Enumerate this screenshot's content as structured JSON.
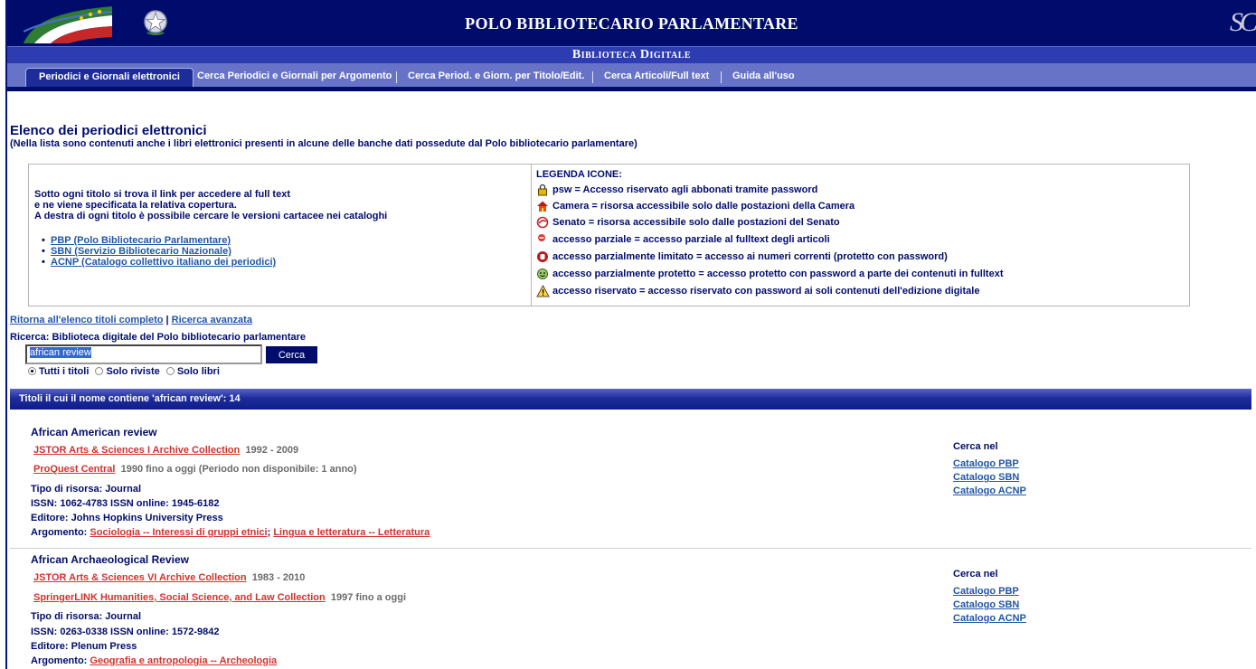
{
  "header": {
    "title": "POLO BIBLIOTECARIO PARLAMENTARE",
    "subtitle": "Biblioteca Digitale",
    "monogram": "SC"
  },
  "nav": {
    "tabs": [
      {
        "label": "Periodici e Giornali elettronici",
        "active": true
      },
      {
        "label": "Cerca Periodici e Giornali per Argomento",
        "active": false
      },
      {
        "label": "Cerca Period. e Giorn. per Titolo/Edit.",
        "active": false
      },
      {
        "label": "Cerca Articoli/Full text",
        "active": false
      },
      {
        "label": "Guida all'uso",
        "active": false
      }
    ]
  },
  "main": {
    "title": "Elenco dei periodici elettronici",
    "subtitle": "(Nella lista sono contenuti anche i libri elettronici presenti in alcune delle banche dati possedute dal Polo bibliotecario parlamentare)"
  },
  "info": {
    "lines": [
      "Sotto ogni titolo si trova il link per accedere al full text",
      "e ne viene specificata la relativa copertura.",
      "A destra di ogni titolo è possibile cercare le versioni cartacee nei cataloghi"
    ],
    "catalogs": [
      "PBP (Polo Bibliotecario Parlamentare)",
      "SBN (Servizio Bibliotecario Nazionale)",
      "ACNP (Catalogo collettivo italiano dei periodici)"
    ]
  },
  "legend": {
    "title": "LEGENDA ICONE:",
    "items": [
      {
        "icon": "lock-icon",
        "text": "psw = Accesso riservato agli abbonati tramite password"
      },
      {
        "icon": "house-icon",
        "text": "Camera = risorsa accessibile solo dalle postazioni della Camera"
      },
      {
        "icon": "senate-icon",
        "text": "Senato = risorsa accessibile solo dalle postazioni del Senato"
      },
      {
        "icon": "partial-access-icon",
        "text": "accesso parziale = accesso parziale al fulltext degli articoli"
      },
      {
        "icon": "hand-stop-icon",
        "text": "accesso parzialmente limitato = accesso ai numeri correnti (protetto con password)"
      },
      {
        "icon": "smiley-icon",
        "text": "accesso parzialmente protetto = accesso protetto con password a parte dei contenuti in fulltext"
      },
      {
        "icon": "warning-icon",
        "text": "accesso riservato = accesso riservato con password ai soli contenuti dell'edizione digitale"
      }
    ]
  },
  "links": {
    "full_list": "Ritorna all'elenco titoli completo",
    "separator": "|",
    "advanced": "Ricerca avanzata"
  },
  "search": {
    "label": "Ricerca: Biblioteca digitale del Polo bibliotecario parlamentare",
    "value": "african review",
    "button": "Cerca",
    "options": [
      "Tutti i titoli",
      "Solo riviste",
      "Solo libri"
    ],
    "selected": "Tutti i titoli"
  },
  "results": {
    "header": "Titoli il cui il nome contiene 'african review': 14",
    "items": [
      {
        "title": "African American review",
        "databases": [
          {
            "name": "JSTOR Arts & Sciences I Archive Collection",
            "coverage": "1992 - 2009"
          },
          {
            "name": "ProQuest Central",
            "coverage": "1990 fino a oggi (Periodo non disponibile: 1 anno)"
          }
        ],
        "type": "Tipo di risorsa: Journal",
        "issn": "ISSN: 1062-4783 ISSN online: 1945-6182",
        "publisher": "Editore: Johns Hopkins University Press",
        "subject_label": "Argomento:",
        "subjects": [
          "Sociologia -- Interessi di gruppi etnici",
          "Lingua e letteratura -- Letteratura"
        ],
        "subject_sep": ";",
        "cerca_title": "Cerca nel",
        "catalogs": [
          "Catalogo PBP",
          "Catalogo SBN",
          "Catalogo ACNP"
        ]
      },
      {
        "title": "African Archaeological Review",
        "databases": [
          {
            "name": "JSTOR Arts & Sciences VI Archive Collection",
            "coverage": "1983 - 2010"
          },
          {
            "name": "SpringerLINK Humanities, Social Science, and Law Collection",
            "coverage": "1997 fino a oggi"
          }
        ],
        "type": "Tipo di risorsa: Journal",
        "issn": "ISSN: 0263-0338 ISSN online: 1572-9842",
        "publisher": "Editore: Plenum Press",
        "subject_label": "Argomento:",
        "subjects": [
          "Geografia e antropologia -- Archeologia"
        ],
        "cerca_title": "Cerca nel",
        "catalogs": [
          "Catalogo PBP",
          "Catalogo SBN",
          "Catalogo ACNP"
        ]
      }
    ]
  },
  "colors": {
    "header_navy": "#000c6c",
    "subheader_blue": "#2d3cb0",
    "nav_lavender": "#6773c7",
    "link_blue": "#2156a5",
    "database_red": "#d2322d"
  }
}
